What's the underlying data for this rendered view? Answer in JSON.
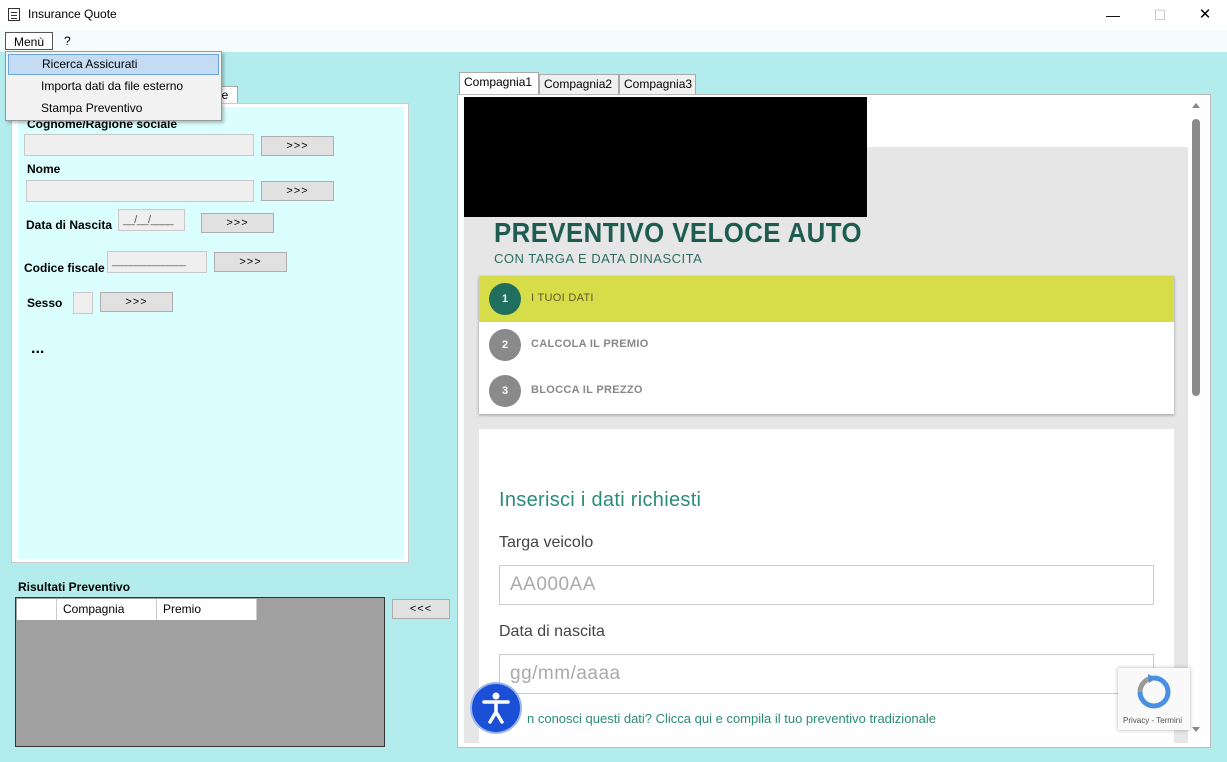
{
  "window": {
    "title": "Insurance Quote",
    "minimize": "—",
    "maximize": "☐",
    "close": "✕"
  },
  "menubar": {
    "menu": "Menù",
    "help": "?"
  },
  "dropdown": {
    "items": [
      "Ricerca Assicurati",
      "Importa dati da file esterno",
      "Stampa Preventivo"
    ],
    "active_index": 0
  },
  "left_tab": {
    "label_fragment": "ne"
  },
  "form": {
    "cognome_label": "Cognome/Ragione sociale",
    "nome_label": "Nome",
    "data_label": "Data di Nascita",
    "data_value": "__/__/____",
    "cf_label": "Codice fiscale",
    "cf_value": "________________",
    "sesso_label": "Sesso",
    "arrow_button": ">>>",
    "more": "..."
  },
  "results": {
    "title": "Risultati Preventivo",
    "columns": [
      "",
      "Compagnia",
      "Premio"
    ],
    "back_button": "<<<"
  },
  "tabs": {
    "items": [
      "Compagnia1",
      "Compagnia2",
      "Compagnia3"
    ],
    "active_index": 0
  },
  "web": {
    "title": "PREVENTIVO VELOCE AUTO",
    "subtitle": "CON TARGA E DATA DINASCITA",
    "steps": [
      {
        "num": "1",
        "label": "I TUOI DATI"
      },
      {
        "num": "2",
        "label": "CALCOLA IL PREMIO"
      },
      {
        "num": "3",
        "label": "BLOCCA IL PREZZO"
      }
    ],
    "form_heading": "Inserisci i dati richiesti",
    "targa_label": "Targa veicolo",
    "targa_placeholder": "AA000AA",
    "nascita_label": "Data di nascita",
    "nascita_placeholder": "gg/mm/aaaa",
    "link_text": "n conosci questi dati? Clicca qui e compila il tuo preventivo tradizionale",
    "recaptcha_text": "Privacy - Termini"
  },
  "colors": {
    "accent_green": "#1f6e5e",
    "step_active": "#d6dd48",
    "background": "#b3ecec",
    "panel": "#dafffe"
  }
}
